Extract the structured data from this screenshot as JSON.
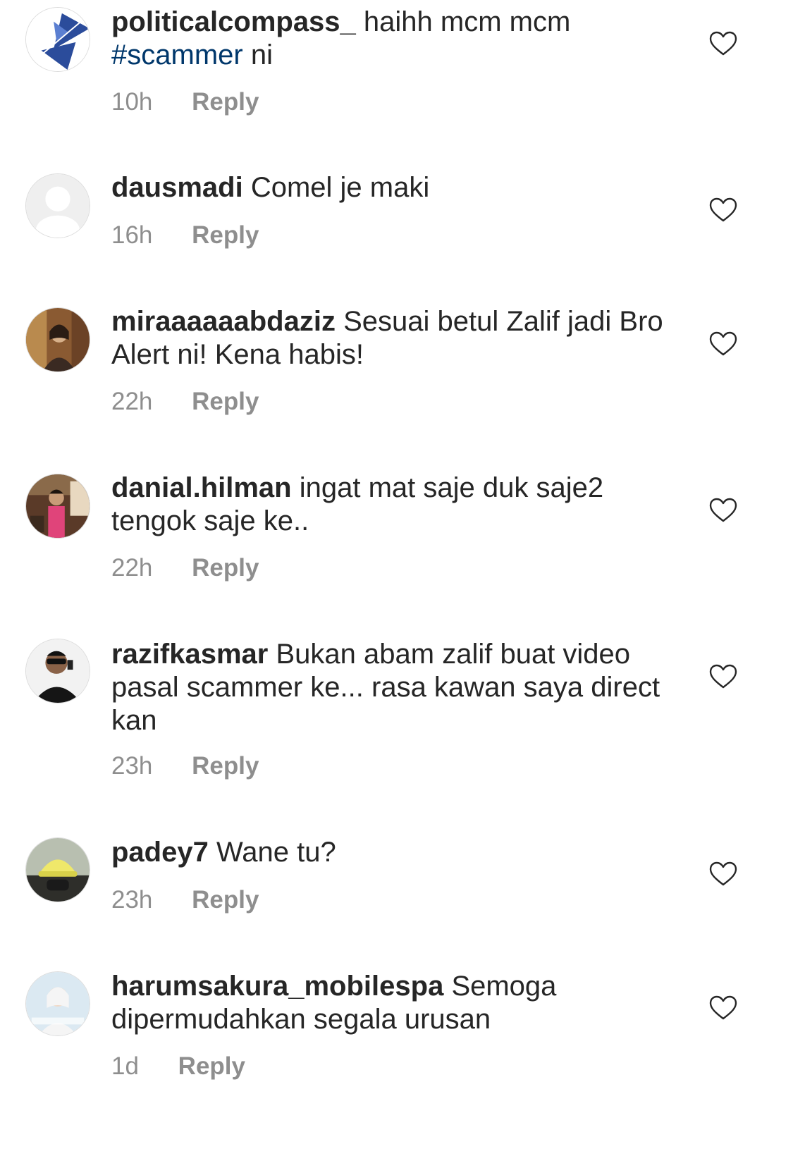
{
  "comments": [
    {
      "username": "politicalcompass_",
      "text_before": "haihh mcm mcm",
      "hashtag": "#scammer",
      "text_after": "ni",
      "time": "10h",
      "reply_label": "Reply",
      "avatar_icon": "political-compass-logo-avatar"
    },
    {
      "username": "dausmadi",
      "text": "Comel je maki",
      "time": "16h",
      "reply_label": "Reply",
      "avatar_icon": "default-user-avatar"
    },
    {
      "username": "miraaaaaabdaziz",
      "text": "Sesuai betul Zalif jadi Bro Alert ni! Kena habis!",
      "time": "22h",
      "reply_label": "Reply",
      "avatar_icon": "user-photo-avatar"
    },
    {
      "username": "danial.hilman",
      "text": "ingat mat saje duk saje2 tengok saje ke..",
      "time": "22h",
      "reply_label": "Reply",
      "avatar_icon": "user-photo-avatar"
    },
    {
      "username": "razifkasmar",
      "text": "Bukan abam zalif buat video pasal scammer ke... rasa kawan saya direct kan",
      "time": "23h",
      "reply_label": "Reply",
      "avatar_icon": "user-photo-avatar"
    },
    {
      "username": "padey7",
      "text": "Wane tu?",
      "time": "23h",
      "reply_label": "Reply",
      "avatar_icon": "user-photo-avatar"
    },
    {
      "username": "harumsakura_mobilespa",
      "text": "Semoga dipermudahkan segala urusan",
      "time": "1d",
      "reply_label": "Reply",
      "avatar_icon": "user-photo-avatar"
    }
  ],
  "colors": {
    "text": "#262626",
    "meta": "#8e8e8e",
    "hashtag": "#00376b"
  },
  "icons": {
    "like": "heart-outline-icon"
  }
}
